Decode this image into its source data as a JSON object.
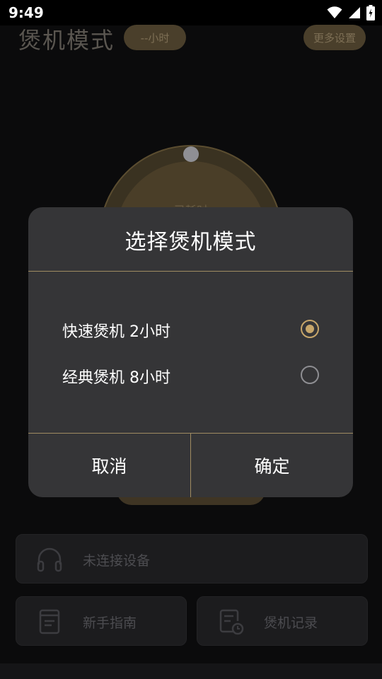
{
  "status_bar": {
    "time": "9:49"
  },
  "app": {
    "title": "煲机模式",
    "hours_pill": "--小时",
    "more_settings": "更多设置",
    "dial_text": "已耗时"
  },
  "cards": {
    "device": "未连接设备",
    "guide": "新手指南",
    "log": "煲机记录"
  },
  "dialog": {
    "title": "选择煲机模式",
    "options": [
      {
        "label": "快速煲机 2小时",
        "selected": true
      },
      {
        "label": "经典煲机 8小时",
        "selected": false
      }
    ],
    "cancel": "取消",
    "confirm": "确定"
  },
  "colors": {
    "accent": "#c7a66a",
    "dialog_bg": "#353537",
    "divider": "#a08c62"
  }
}
